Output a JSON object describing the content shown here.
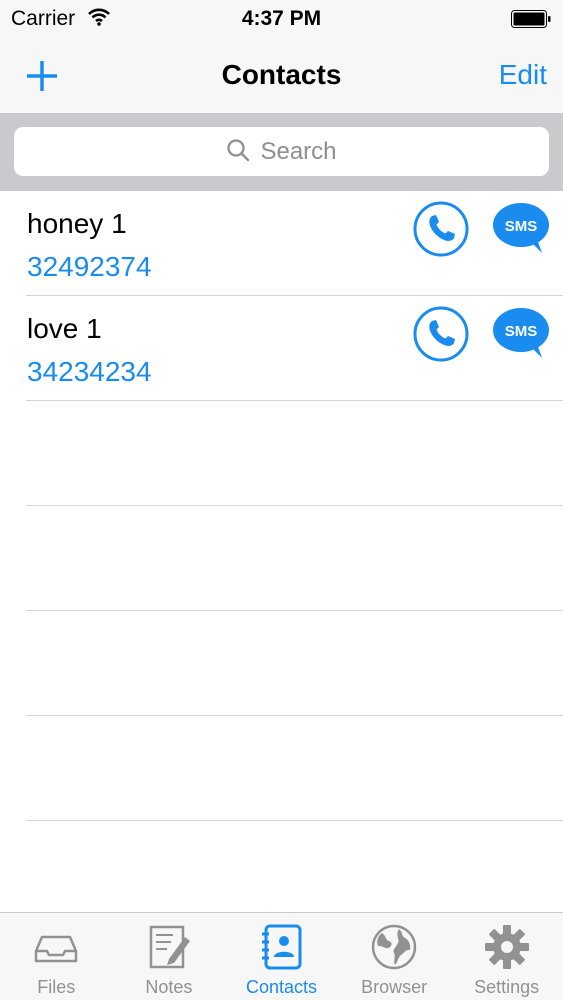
{
  "status_bar": {
    "carrier": "Carrier",
    "time": "4:37 PM"
  },
  "nav": {
    "title": "Contacts",
    "edit_label": "Edit"
  },
  "search": {
    "placeholder": "Search"
  },
  "contacts": [
    {
      "name": "honey 1",
      "number": "32492374"
    },
    {
      "name": "love 1",
      "number": "34234234"
    }
  ],
  "tabs": [
    {
      "label": "Files",
      "icon": "tray-icon",
      "active": false
    },
    {
      "label": "Notes",
      "icon": "note-pencil-icon",
      "active": false
    },
    {
      "label": "Contacts",
      "icon": "address-book-icon",
      "active": true
    },
    {
      "label": "Browser",
      "icon": "globe-icon",
      "active": false
    },
    {
      "label": "Settings",
      "icon": "gear-icon",
      "active": false
    }
  ],
  "colors": {
    "accent": "#1a8cf0",
    "inactive": "#929292",
    "search_bg": "#c9c9ce"
  },
  "sms_badge_text": "SMS"
}
